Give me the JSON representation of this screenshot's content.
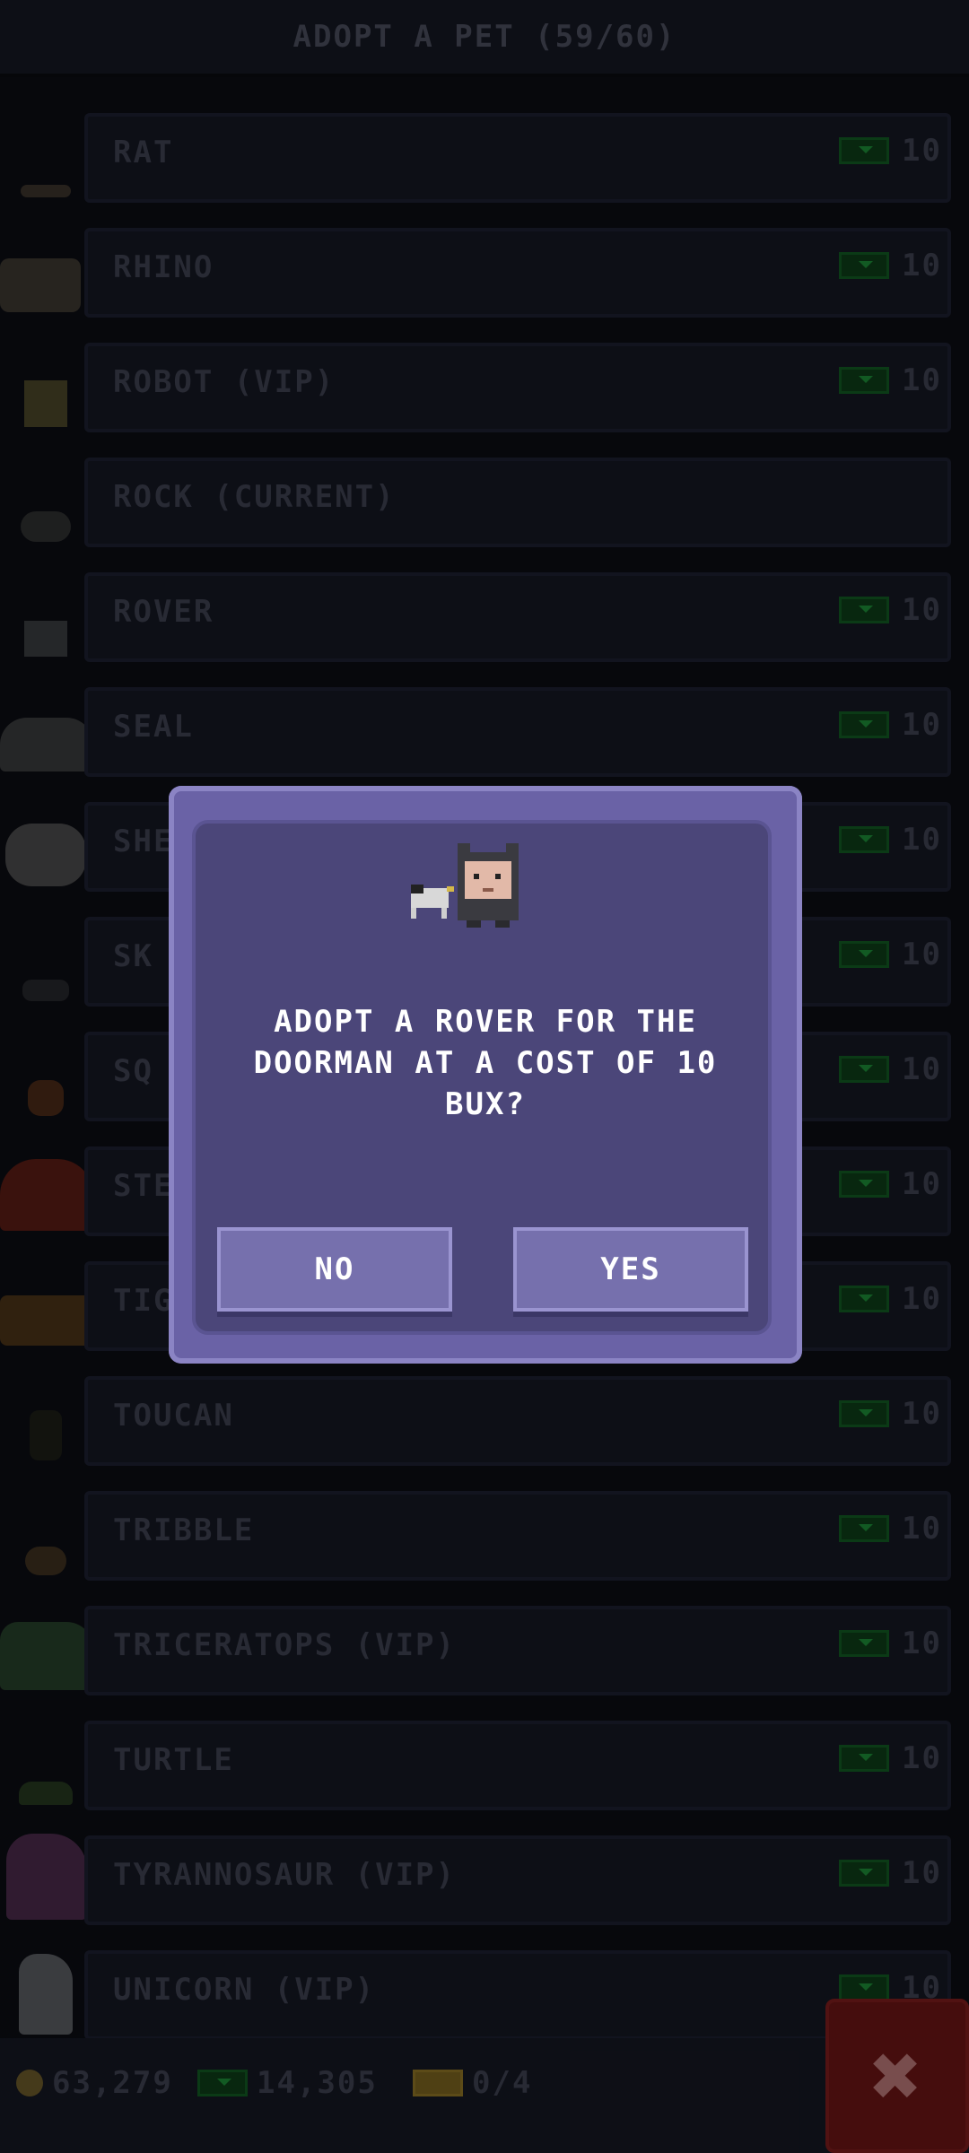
{
  "header": {
    "title": "ADOPT A PET (59/60)"
  },
  "pets": [
    {
      "name": "RAT",
      "price": "10",
      "icon": "rat-icon"
    },
    {
      "name": "RHINO",
      "price": "10",
      "icon": "rhino-icon"
    },
    {
      "name": "ROBOT (VIP)",
      "price": "10",
      "icon": "robot-icon"
    },
    {
      "name": "ROCK (CURRENT)",
      "price": "",
      "icon": "rock-icon"
    },
    {
      "name": "ROVER",
      "price": "10",
      "icon": "rover-icon"
    },
    {
      "name": "SEAL",
      "price": "10",
      "icon": "seal-icon"
    },
    {
      "name": "SHE",
      "price": "10",
      "icon": "sheep-icon"
    },
    {
      "name": "SK",
      "price": "10",
      "icon": "skunk-icon"
    },
    {
      "name": "SQ",
      "price": "10",
      "icon": "squirrel-icon"
    },
    {
      "name": "STE",
      "price": "10",
      "icon": "stegosaurus-icon"
    },
    {
      "name": "TIG",
      "price": "10",
      "icon": "tiger-icon"
    },
    {
      "name": "TOUCAN",
      "price": "10",
      "icon": "toucan-icon"
    },
    {
      "name": "TRIBBLE",
      "price": "10",
      "icon": "tribble-icon"
    },
    {
      "name": "TRICERATOPS (VIP)",
      "price": "10",
      "icon": "triceratops-icon"
    },
    {
      "name": "TURTLE",
      "price": "10",
      "icon": "turtle-icon"
    },
    {
      "name": "TYRANNOSAUR (VIP)",
      "price": "10",
      "icon": "tyrannosaur-icon"
    },
    {
      "name": "UNICORN (VIP)",
      "price": "10",
      "icon": "unicorn-icon"
    }
  ],
  "dialog": {
    "message": "ADOPT A ROVER FOR THE DOORMAN AT A COST OF 10 BUX?",
    "no_label": "NO",
    "yes_label": "YES"
  },
  "footer": {
    "coins": "63,279",
    "bux": "14,305",
    "tickets": "0/4"
  },
  "colors": {
    "dialog": "#6a62a6",
    "close": "#6a1515",
    "bux_green": "#125a22"
  }
}
